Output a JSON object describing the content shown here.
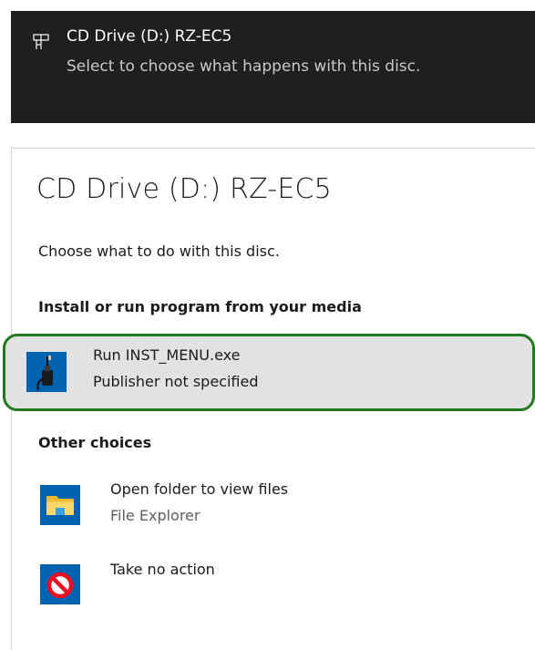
{
  "toast": {
    "icon": "cd-drive-icon",
    "title": "CD Drive (D:) RZ-EC5",
    "body": "Select to choose what happens with this disc."
  },
  "dialog": {
    "title": "CD Drive (D:) RZ-EC5",
    "subtitle": "Choose what to do with this disc.",
    "sections": {
      "install": {
        "heading": "Install or run program from your media",
        "option": {
          "icon": "usb-device-icon",
          "label": "Run INST_MENU.exe",
          "detail": "Publisher not specified",
          "selected": true
        }
      },
      "other": {
        "heading": "Other choices",
        "options": [
          {
            "icon": "folder-icon",
            "label": "Open folder to view files",
            "detail": "File Explorer"
          },
          {
            "icon": "no-action-icon",
            "label": "Take no action"
          }
        ]
      }
    }
  },
  "colors": {
    "toast_background": "#1f1f1f",
    "toast_text": "#ffffff",
    "toast_secondary_text": "#c9c9c9",
    "selection_background": "#e2e2e2",
    "selection_border": "#217a1e",
    "icon_tile_blue": "#0063b1",
    "no_action_red": "#e81123"
  }
}
